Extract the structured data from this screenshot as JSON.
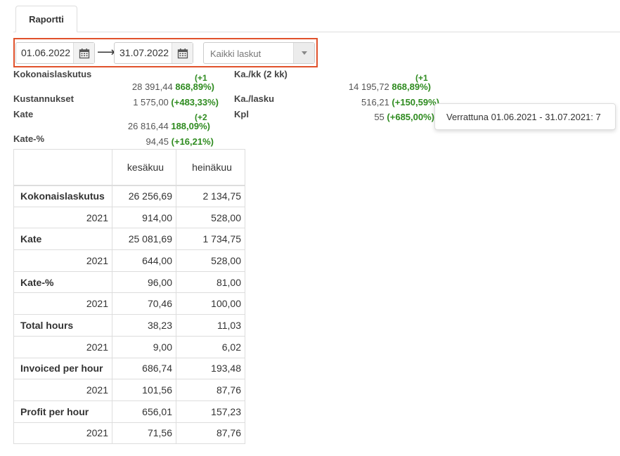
{
  "tabs": [
    {
      "label": "Raportti"
    }
  ],
  "filters": {
    "start_date": "01.06.2022",
    "arrow": "⟶",
    "end_date": "31.07.2022",
    "invoice_select": "Kaikki laskut"
  },
  "summary": {
    "kokonaislaskutus": {
      "label": "Kokonaislaskutus",
      "value": "28 391,44",
      "change_top": "(+1",
      "change": "868,89%)"
    },
    "kustannukset": {
      "label": "Kustannukset",
      "value": "1 575,00",
      "change": "(+483,33%)"
    },
    "kate": {
      "label": "Kate",
      "value": "26 816,44",
      "change_top": "(+2",
      "change": "188,09%)"
    },
    "kate_pct": {
      "label": "Kate-%",
      "value": "94,45",
      "change": "(+16,21%)"
    },
    "ka_kk": {
      "label": "Ka./kk (2 kk)",
      "value": "14 195,72",
      "change_top": "(+1",
      "change": "868,89%)"
    },
    "ka_lasku": {
      "label": "Ka./lasku",
      "value": "516,21",
      "change": "(+150,59%)"
    },
    "kpl": {
      "label": "Kpl",
      "value": "55",
      "change": "(+685,00%)"
    }
  },
  "tooltip": "Verrattuna 01.06.2021 - 31.07.2021: 7",
  "table": {
    "columns": [
      "",
      "kesäkuu",
      "heinäkuu"
    ],
    "rows": [
      {
        "label": "Kokonaislaskutus",
        "bold": true,
        "values": [
          "26 256,69",
          "2 134,75"
        ]
      },
      {
        "label": "2021",
        "bold": false,
        "values": [
          "914,00",
          "528,00"
        ]
      },
      {
        "label": "Kate",
        "bold": true,
        "values": [
          "25 081,69",
          "1 734,75"
        ]
      },
      {
        "label": "2021",
        "bold": false,
        "values": [
          "644,00",
          "528,00"
        ]
      },
      {
        "label": "Kate-%",
        "bold": true,
        "values": [
          "96,00",
          "81,00"
        ]
      },
      {
        "label": "2021",
        "bold": false,
        "values": [
          "70,46",
          "100,00"
        ]
      },
      {
        "label": "Total hours",
        "bold": true,
        "values": [
          "38,23",
          "11,03"
        ]
      },
      {
        "label": "2021",
        "bold": false,
        "values": [
          "9,00",
          "6,02"
        ]
      },
      {
        "label": "Invoiced per hour",
        "bold": true,
        "values": [
          "686,74",
          "193,48"
        ]
      },
      {
        "label": "2021",
        "bold": false,
        "values": [
          "101,56",
          "87,76"
        ]
      },
      {
        "label": "Profit per hour",
        "bold": true,
        "values": [
          "656,01",
          "157,23"
        ]
      },
      {
        "label": "2021",
        "bold": false,
        "values": [
          "71,56",
          "87,76"
        ]
      }
    ]
  },
  "colors": {
    "highlight": "#e0512b",
    "positive": "#2e8b1f",
    "border": "#dddddd"
  },
  "icons": {
    "calendar": "calendar-icon",
    "dropdown": "chevron-down-icon"
  }
}
